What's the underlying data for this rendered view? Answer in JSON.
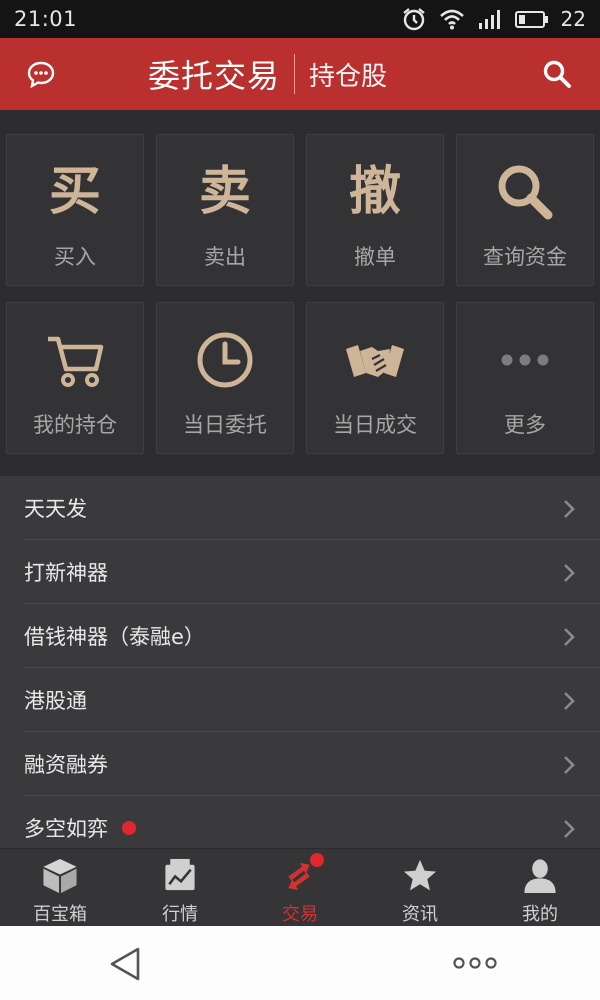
{
  "status_bar": {
    "time": "21:01",
    "battery_level": "22",
    "icons": [
      "alarm-icon",
      "wifi-icon",
      "signal-4g-icon",
      "battery-icon"
    ]
  },
  "header": {
    "title": "委托交易",
    "subtab": "持仓股",
    "left_icon": "chat-icon",
    "right_icon": "search-icon",
    "background": "#b9302e"
  },
  "grid": {
    "row1": [
      {
        "glyph": "买",
        "label": "买入"
      },
      {
        "glyph": "卖",
        "label": "卖出"
      },
      {
        "glyph": "撤",
        "label": "撤单"
      },
      {
        "icon": "magnifier-icon",
        "label": "查询资金"
      }
    ],
    "row2": [
      {
        "icon": "cart-icon",
        "label": "我的持仓"
      },
      {
        "icon": "clock-icon",
        "label": "当日委托"
      },
      {
        "icon": "handshake-icon",
        "label": "当日成交"
      },
      {
        "icon": "more-dots-icon",
        "label": "更多"
      }
    ],
    "accent": "#ceb598"
  },
  "list": {
    "items": [
      {
        "label": "天天发"
      },
      {
        "label": "打新神器"
      },
      {
        "label": "借钱神器（泰融e）"
      },
      {
        "label": "港股通"
      },
      {
        "label": "融资融券"
      },
      {
        "label": "多空如弈",
        "has_dot": true
      }
    ]
  },
  "tabbar": {
    "tabs": [
      {
        "label": "百宝箱",
        "icon": "cube-icon"
      },
      {
        "label": "行情",
        "icon": "market-chart-icon"
      },
      {
        "label": "交易",
        "icon": "trade-arrows-icon",
        "active": true
      },
      {
        "label": "资讯",
        "icon": "star-icon"
      },
      {
        "label": "我的",
        "icon": "person-icon"
      }
    ],
    "active_color": "#d2322f"
  }
}
